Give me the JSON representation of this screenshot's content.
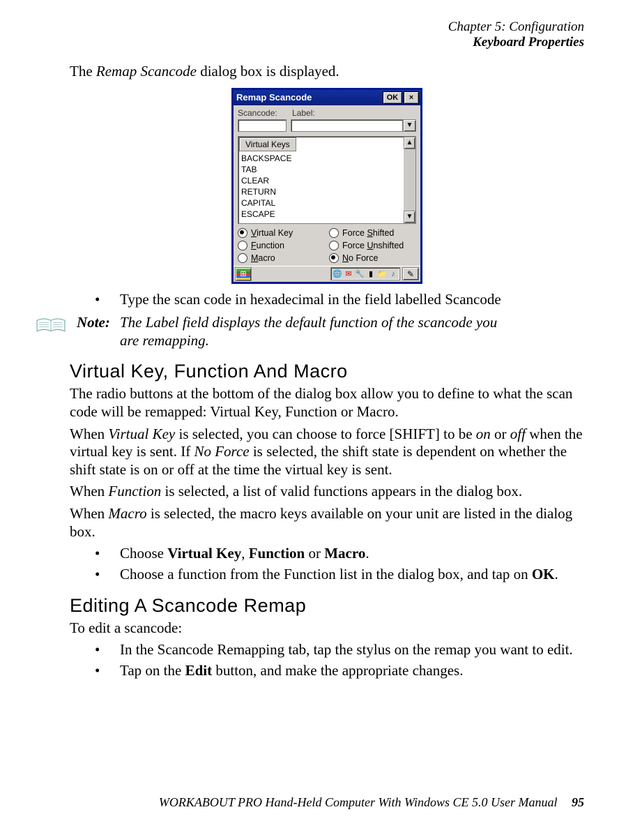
{
  "header": {
    "chapter": "Chapter 5: Configuration",
    "section": "Keyboard Properties"
  },
  "intro": {
    "pre": "The ",
    "ital": "Remap Scancode",
    "post": " dialog box is displayed."
  },
  "dialog": {
    "title": "Remap Scancode",
    "ok": "OK",
    "close_glyph": "×",
    "labels": {
      "scancode": "Scancode:",
      "label": "Label:"
    },
    "dropdown_glyph": "▼",
    "listbox": {
      "tab": "Virtual Keys",
      "items": [
        "BACKSPACE",
        "TAB",
        "CLEAR",
        "RETURN",
        "CAPITAL",
        "ESCAPE"
      ]
    },
    "scroll_up": "▲",
    "scroll_down": "▼",
    "radios": {
      "virtual_key": {
        "label_pre": "",
        "u": "V",
        "label_post": "irtual Key",
        "selected": true
      },
      "force_shifted": {
        "label_pre": "Force ",
        "u": "S",
        "label_post": "hifted",
        "selected": false
      },
      "function": {
        "label_pre": "",
        "u": "F",
        "label_post": "unction",
        "selected": false
      },
      "force_unshifted": {
        "label_pre": "Force ",
        "u": "U",
        "label_post": "nshifted",
        "selected": false
      },
      "macro": {
        "label_pre": "",
        "u": "M",
        "label_post": "acro",
        "selected": false
      },
      "no_force": {
        "label_pre": "",
        "u": "N",
        "label_post": "o Force",
        "selected": true
      }
    },
    "taskbar": {
      "start": "⊞",
      "tray_icons": [
        "🌐",
        "✉",
        "🔧",
        "▮",
        "📁",
        "♪"
      ],
      "sip": "✎"
    }
  },
  "bullet_scancode": {
    "pre": "Type the scan code in hexadecimal in the field labelled ",
    "ital": "Scancode"
  },
  "note": {
    "label": "Note:",
    "line1": "The Label field displays the default function of the scancode you",
    "line2": "are remapping."
  },
  "h_vkfm": "Virtual Key, Function And Macro",
  "p1": "The radio buttons at the bottom of the dialog box allow you to define to what the scan code will be remapped: Virtual Key, Function or Macro.",
  "p2": {
    "a": "When ",
    "i1": "Virtual Key",
    "b": " is selected, you can choose to force [SHIFT] to be ",
    "i2": "on",
    "c": " or ",
    "i3": "off",
    "d": " when the virtual key is sent. If ",
    "i4": "No Force",
    "e": " is selected, the shift state is dependent on whether the shift state is on or off at the time the virtual key is sent."
  },
  "p3": {
    "a": "When ",
    "i1": "Function",
    "b": " is selected, a list of valid functions appears in the dialog box."
  },
  "p4": {
    "a": "When ",
    "i1": "Macro",
    "b": " is selected, the macro keys available on your unit are listed in the dialog box."
  },
  "bullets_choose": {
    "b1": {
      "a": "Choose ",
      "s1": "Virtual Key",
      "b": ", ",
      "s2": "Function",
      "c": " or ",
      "s3": "Macro",
      "d": "."
    },
    "b2": {
      "a": "Choose a function from the ",
      "i1": "Function",
      "b": " list in the dialog box, and tap on ",
      "s1": "OK",
      "c": "."
    }
  },
  "h_edit": "Editing A Scancode Remap",
  "p5": "To edit a scancode:",
  "bullets_edit": {
    "b1": {
      "a": "In the ",
      "i1": "Scancode Remapping",
      "b": " tab, tap the stylus on the remap you want to edit."
    },
    "b2": {
      "a": "Tap on the ",
      "s1": "Edit",
      "b": " button, and make the appropriate changes."
    }
  },
  "footer": {
    "text": "WORKABOUT PRO Hand-Held Computer With Windows CE 5.0 User Manual",
    "page": "95"
  }
}
